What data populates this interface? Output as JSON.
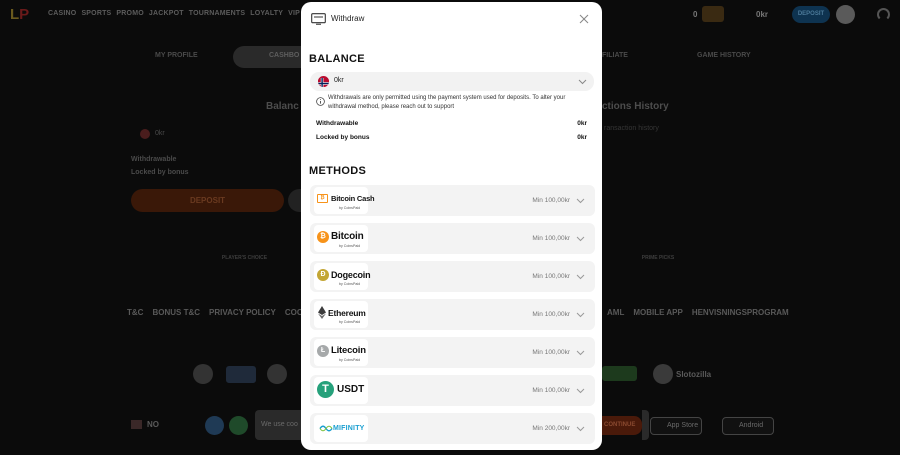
{
  "background": {
    "top_nav": [
      "CASINO",
      "SPORTS",
      "PROMO",
      "JACKPOT",
      "TOURNAMENTS",
      "LOYALTY",
      "VIP"
    ],
    "balance_amount": "0",
    "balance_currency": "0kr",
    "deposit_top_label": "DEPOSIT",
    "tabs": {
      "profile": "MY PROFILE",
      "cashbox": "CASHBO",
      "affiliate": "FILIATE",
      "history": "GAME HISTORY"
    },
    "balance_heading": "Balanc",
    "transactions_heading": "ctions History",
    "transactions_sub": "ransaction history",
    "okr": "0kr",
    "withdrawable": "Withdrawable",
    "locked": "Locked by bonus",
    "deposit_button": "DEPOSIT",
    "award_left": "PLAYER'S CHOICE",
    "award_right": "PRIME PICKS",
    "footer_links_left": [
      "T&C",
      "BONUS T&C",
      "PRIVACY POLICY",
      "COOKIE"
    ],
    "footer_links_right": [
      "AML",
      "MOBILE APP",
      "HENVISNINGSPROGRAM"
    ],
    "slots_brand": "Slotozilla",
    "language": "NO",
    "cookie_text": "We use coo",
    "continue_button": "CONTINUE",
    "app_store": "App Store",
    "android": "Android"
  },
  "modal": {
    "title": "Withdraw",
    "balance_title": "BALANCE",
    "currency": "0kr",
    "info": "Withdrawals are only permitted using the payment system used for deposits. To alter your withdrawal method, please reach out to support",
    "withdrawable_label": "Withdrawable",
    "withdrawable_value": "0kr",
    "locked_label": "Locked by bonus",
    "locked_value": "0kr",
    "methods_title": "METHODS",
    "methods": [
      {
        "name": "Bitcoin Cash",
        "by": "by CoinsPaid",
        "min": "Min 100,00kr"
      },
      {
        "name": "Bitcoin",
        "by": "by CoinsPaid",
        "min": "Min 100,00kr"
      },
      {
        "name": "Dogecoin",
        "by": "by CoinsPaid",
        "min": "Min 100,00kr"
      },
      {
        "name": "Ethereum",
        "by": "by CoinsPaid",
        "min": "Min 100,00kr"
      },
      {
        "name": "Litecoin",
        "by": "by CoinsPaid",
        "min": "Min 100,00kr"
      },
      {
        "name": "USDT",
        "by": "",
        "min": "Min 100,00kr"
      },
      {
        "name": "MIFINITY",
        "by": "",
        "min": "Min 200,00kr"
      }
    ],
    "colors": {
      "bitcoin": "#f7931a",
      "dogecoin": "#c3a634",
      "ethereum": "#3c3c3d",
      "litecoin": "#a6a9aa",
      "usdt": "#26a17b",
      "mifinity": "#1a9fd1"
    }
  }
}
